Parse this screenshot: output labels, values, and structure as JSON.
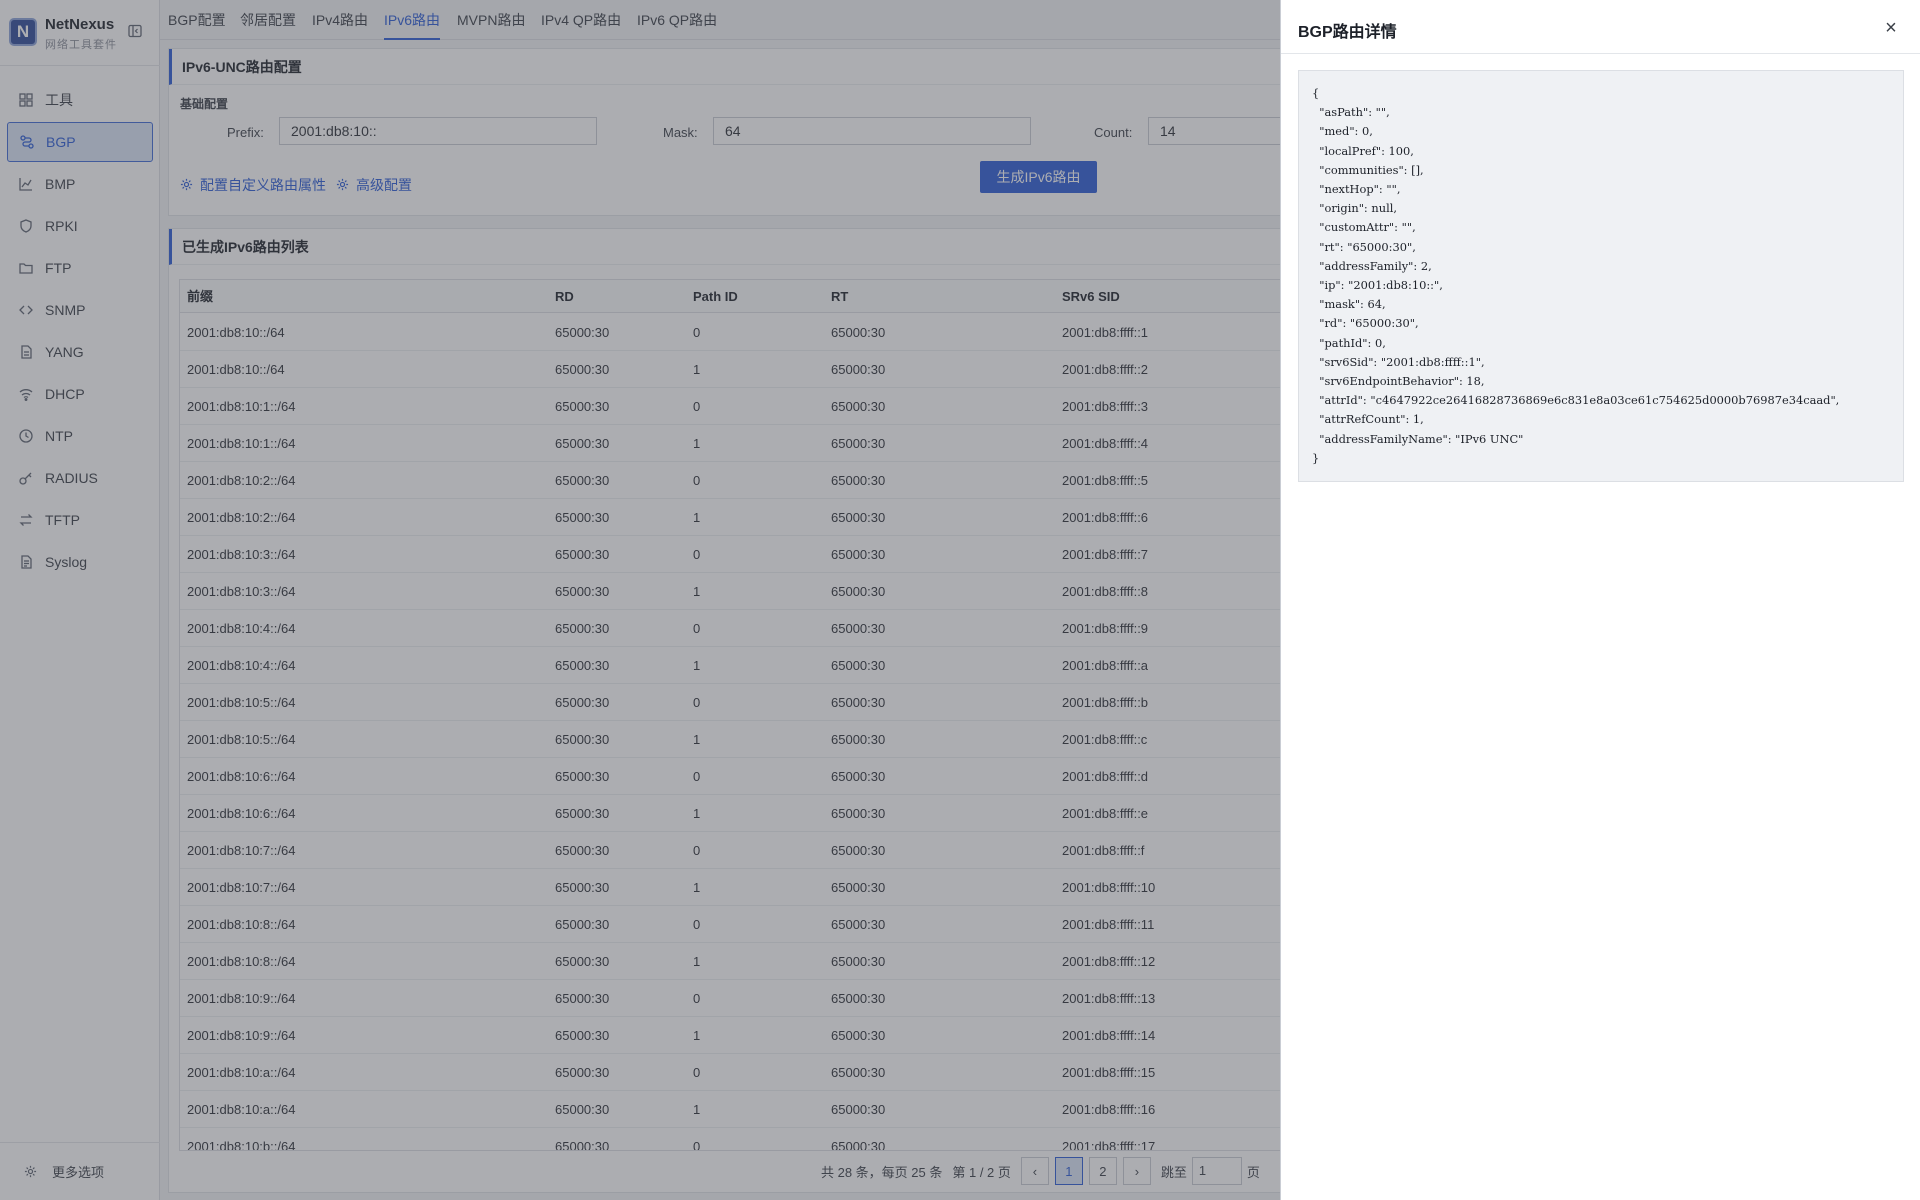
{
  "brand": {
    "logo": "N",
    "name": "NetNexus",
    "subtitle": "网络工具套件"
  },
  "sidebar": {
    "items": [
      {
        "label": "工具",
        "icon": "grid-icon"
      },
      {
        "label": "BGP",
        "icon": "route-icon",
        "active": true
      },
      {
        "label": "BMP",
        "icon": "chart-icon"
      },
      {
        "label": "RPKI",
        "icon": "shield-icon"
      },
      {
        "label": "FTP",
        "icon": "folder-icon"
      },
      {
        "label": "SNMP",
        "icon": "code-icon"
      },
      {
        "label": "YANG",
        "icon": "file-icon"
      },
      {
        "label": "DHCP",
        "icon": "wifi-icon"
      },
      {
        "label": "NTP",
        "icon": "clock-icon"
      },
      {
        "label": "RADIUS",
        "icon": "key-icon"
      },
      {
        "label": "TFTP",
        "icon": "transfer-icon"
      },
      {
        "label": "Syslog",
        "icon": "log-icon"
      }
    ],
    "footer_label": "更多选项"
  },
  "tabs": [
    {
      "label": "BGP配置"
    },
    {
      "label": "邻居配置"
    },
    {
      "label": "IPv4路由"
    },
    {
      "label": "IPv6路由",
      "active": true
    },
    {
      "label": "MVPN路由"
    },
    {
      "label": "IPv4 QP路由"
    },
    {
      "label": "IPv6 QP路由"
    }
  ],
  "config": {
    "title": "IPv6-UNC路由配置",
    "section": "基础配置",
    "prefix_label": "Prefix:",
    "prefix_value": "2001:db8:10::",
    "mask_label": "Mask:",
    "mask_value": "64",
    "count_label": "Count:",
    "count_value": "14",
    "custom_attr_link": "配置自定义路由属性",
    "advanced_link": "高级配置",
    "generate_button": "生成IPv6路由"
  },
  "routes": {
    "title": "已生成IPv6路由列表",
    "columns": [
      "前缀",
      "RD",
      "Path ID",
      "RT",
      "SRv6 SID"
    ],
    "rows": [
      [
        "2001:db8:10::/64",
        "65000:30",
        "0",
        "65000:30",
        "2001:db8:ffff::1"
      ],
      [
        "2001:db8:10::/64",
        "65000:30",
        "1",
        "65000:30",
        "2001:db8:ffff::2"
      ],
      [
        "2001:db8:10:1::/64",
        "65000:30",
        "0",
        "65000:30",
        "2001:db8:ffff::3"
      ],
      [
        "2001:db8:10:1::/64",
        "65000:30",
        "1",
        "65000:30",
        "2001:db8:ffff::4"
      ],
      [
        "2001:db8:10:2::/64",
        "65000:30",
        "0",
        "65000:30",
        "2001:db8:ffff::5"
      ],
      [
        "2001:db8:10:2::/64",
        "65000:30",
        "1",
        "65000:30",
        "2001:db8:ffff::6"
      ],
      [
        "2001:db8:10:3::/64",
        "65000:30",
        "0",
        "65000:30",
        "2001:db8:ffff::7"
      ],
      [
        "2001:db8:10:3::/64",
        "65000:30",
        "1",
        "65000:30",
        "2001:db8:ffff::8"
      ],
      [
        "2001:db8:10:4::/64",
        "65000:30",
        "0",
        "65000:30",
        "2001:db8:ffff::9"
      ],
      [
        "2001:db8:10:4::/64",
        "65000:30",
        "1",
        "65000:30",
        "2001:db8:ffff::a"
      ],
      [
        "2001:db8:10:5::/64",
        "65000:30",
        "0",
        "65000:30",
        "2001:db8:ffff::b"
      ],
      [
        "2001:db8:10:5::/64",
        "65000:30",
        "1",
        "65000:30",
        "2001:db8:ffff::c"
      ],
      [
        "2001:db8:10:6::/64",
        "65000:30",
        "0",
        "65000:30",
        "2001:db8:ffff::d"
      ],
      [
        "2001:db8:10:6::/64",
        "65000:30",
        "1",
        "65000:30",
        "2001:db8:ffff::e"
      ],
      [
        "2001:db8:10:7::/64",
        "65000:30",
        "0",
        "65000:30",
        "2001:db8:ffff::f"
      ],
      [
        "2001:db8:10:7::/64",
        "65000:30",
        "1",
        "65000:30",
        "2001:db8:ffff::10"
      ],
      [
        "2001:db8:10:8::/64",
        "65000:30",
        "0",
        "65000:30",
        "2001:db8:ffff::11"
      ],
      [
        "2001:db8:10:8::/64",
        "65000:30",
        "1",
        "65000:30",
        "2001:db8:ffff::12"
      ],
      [
        "2001:db8:10:9::/64",
        "65000:30",
        "0",
        "65000:30",
        "2001:db8:ffff::13"
      ],
      [
        "2001:db8:10:9::/64",
        "65000:30",
        "1",
        "65000:30",
        "2001:db8:ffff::14"
      ],
      [
        "2001:db8:10:a::/64",
        "65000:30",
        "0",
        "65000:30",
        "2001:db8:ffff::15"
      ],
      [
        "2001:db8:10:a::/64",
        "65000:30",
        "1",
        "65000:30",
        "2001:db8:ffff::16"
      ],
      [
        "2001:db8:10:b::/64",
        "65000:30",
        "0",
        "65000:30",
        "2001:db8:ffff::17"
      ]
    ]
  },
  "pagination": {
    "summary": "共 28 条，每页 25 条",
    "page_info": "第 1 / 2 页",
    "prev": "‹",
    "pages": [
      "1",
      "2"
    ],
    "next": "›",
    "jump_label": "跳至",
    "jump_value": "1",
    "page_suffix": "页"
  },
  "drawer": {
    "title": "BGP路由详情",
    "close": "×",
    "json_text": "{\n  \"asPath\": \"\",\n  \"med\": 0,\n  \"localPref\": 100,\n  \"communities\": [],\n  \"nextHop\": \"\",\n  \"origin\": null,\n  \"customAttr\": \"\",\n  \"rt\": \"65000:30\",\n  \"addressFamily\": 2,\n  \"ip\": \"2001:db8:10::\",\n  \"mask\": 64,\n  \"rd\": \"65000:30\",\n  \"pathId\": 0,\n  \"srv6Sid\": \"2001:db8:ffff::1\",\n  \"srv6EndpointBehavior\": 18,\n  \"attrId\": \"c4647922ce26416828736869e6c831e8a03ce61c754625d0000b76987e34caad\",\n  \"attrRefCount\": 1,\n  \"addressFamilyName\": \"IPv6 UNC\"\n}"
  },
  "colors": {
    "accent": "#2a5bd7",
    "active_bg": "#dbe6f8",
    "overlay": "#464a52"
  }
}
